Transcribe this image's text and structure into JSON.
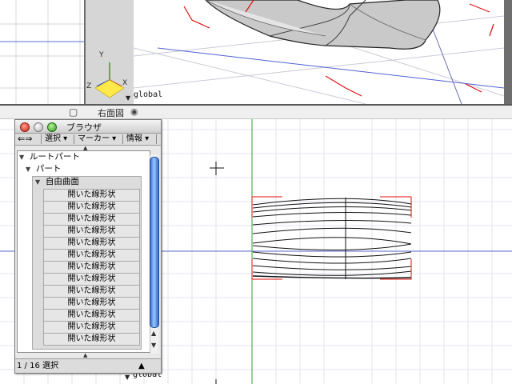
{
  "viewports": {
    "top": {
      "global_label": "global",
      "axes": {
        "x": "X",
        "y": "Y",
        "z": "Z"
      }
    },
    "right": {
      "title": "右面図",
      "global_label": "global"
    }
  },
  "browser": {
    "title": "ブラウザ",
    "toolbar": {
      "select": "選択",
      "marker": "マーカー",
      "info": "情報"
    },
    "tree": {
      "root": "ルートパート",
      "part": "パート",
      "surface": "自由曲面",
      "leaves": [
        "開いた線形状",
        "開いた線形状",
        "開いた線形状",
        "開いた線形状",
        "開いた線形状",
        "開いた線形状",
        "開いた線形状",
        "開いた線形状",
        "開いた線形状",
        "開いた線形状",
        "開いた線形状",
        "開いた線形状",
        "開いた線形状"
      ]
    },
    "status": "1 / 16 選択"
  },
  "colors": {
    "axis_x": "#e03030",
    "axis_y": "#2fa02f",
    "axis_z": "#2f4fd0",
    "selection": "#e01010",
    "grid": "#cfd3e0"
  }
}
